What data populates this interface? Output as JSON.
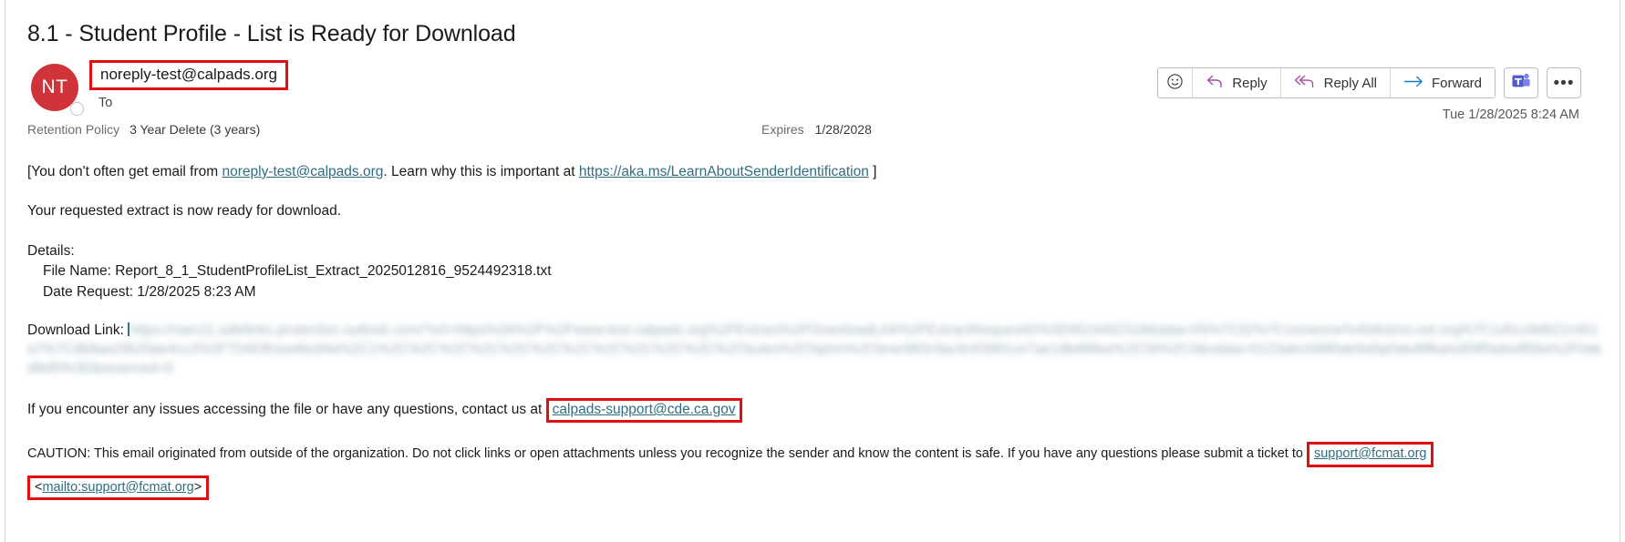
{
  "email": {
    "subject": "8.1 - Student Profile - List is Ready for Download",
    "avatar_initials": "NT",
    "sender_email": "noreply-test@calpads.org",
    "to_label": "To",
    "retention_label": "Retention Policy",
    "retention_value": "3 Year Delete (3 years)",
    "expires_label": "Expires",
    "expires_value": "1/28/2028",
    "timestamp": "Tue 1/28/2025 8:24 AM"
  },
  "toolbar": {
    "emoji_icon": "smiley-icon",
    "reply_label": "Reply",
    "reply_all_label": "Reply All",
    "forward_label": "Forward",
    "teams_icon": "teams-icon",
    "more_label": "•••"
  },
  "banner": {
    "prefix": "[You don't often get email from ",
    "sender_link": "noreply-test@calpads.org",
    "middle": ". Learn why this is important at ",
    "learn_link": "https://aka.ms/LearnAboutSenderIdentification",
    "suffix": " ]"
  },
  "body": {
    "intro": "Your requested extract is now ready for download.",
    "details_heading": "Details:",
    "file_name_line": "File Name: Report_8_1_StudentProfileList_Extract_2025012816_9524492318.txt",
    "date_request_line": "Date Request: 1/28/2025 8:23 AM",
    "download_label": "Download Link: ",
    "download_url_redacted": "https://nam11.safelinks.protection.outlook.com/?url=https%3A%2F%2Fwww.test.calpads.org%2FExtract%2FDownloadLink%2FExtractRequestID%3D9524492318&data=05%7C02%7Csomeone%40district.net.org%7C1d5cc9d922c451a7%7Cdb8ae29b20ae4cc3%2F72463fcea4bc84a%2C1%2C%2C%2C%2C%2C%2C%2C%2C%2C%2C%2C%2Cbutes%2Chphm%2Cbrwr983c9ac6c93981ce7ae1dbd99ea%2C56%2C0&sdata=0123abc0d9f0ak9sl0p0akd9fkalsd09f0a9sdf09a%2F0akd9sf0%3D&reserved=0",
    "contact_prefix": "If you encounter any issues accessing the file or have any questions, contact us at ",
    "contact_link": "calpads-support@cde.ca.gov"
  },
  "caution": {
    "text_prefix": "CAUTION: This email originated from outside of the organization. Do not click links or open attachments unless you recognize the sender and know the content is safe. If you have any questions please submit a ticket to ",
    "support_link": "support@fcmat.org",
    "mailto_open": "<",
    "mailto_link": "mailto:support@fcmat.org",
    "mailto_close": ">"
  }
}
